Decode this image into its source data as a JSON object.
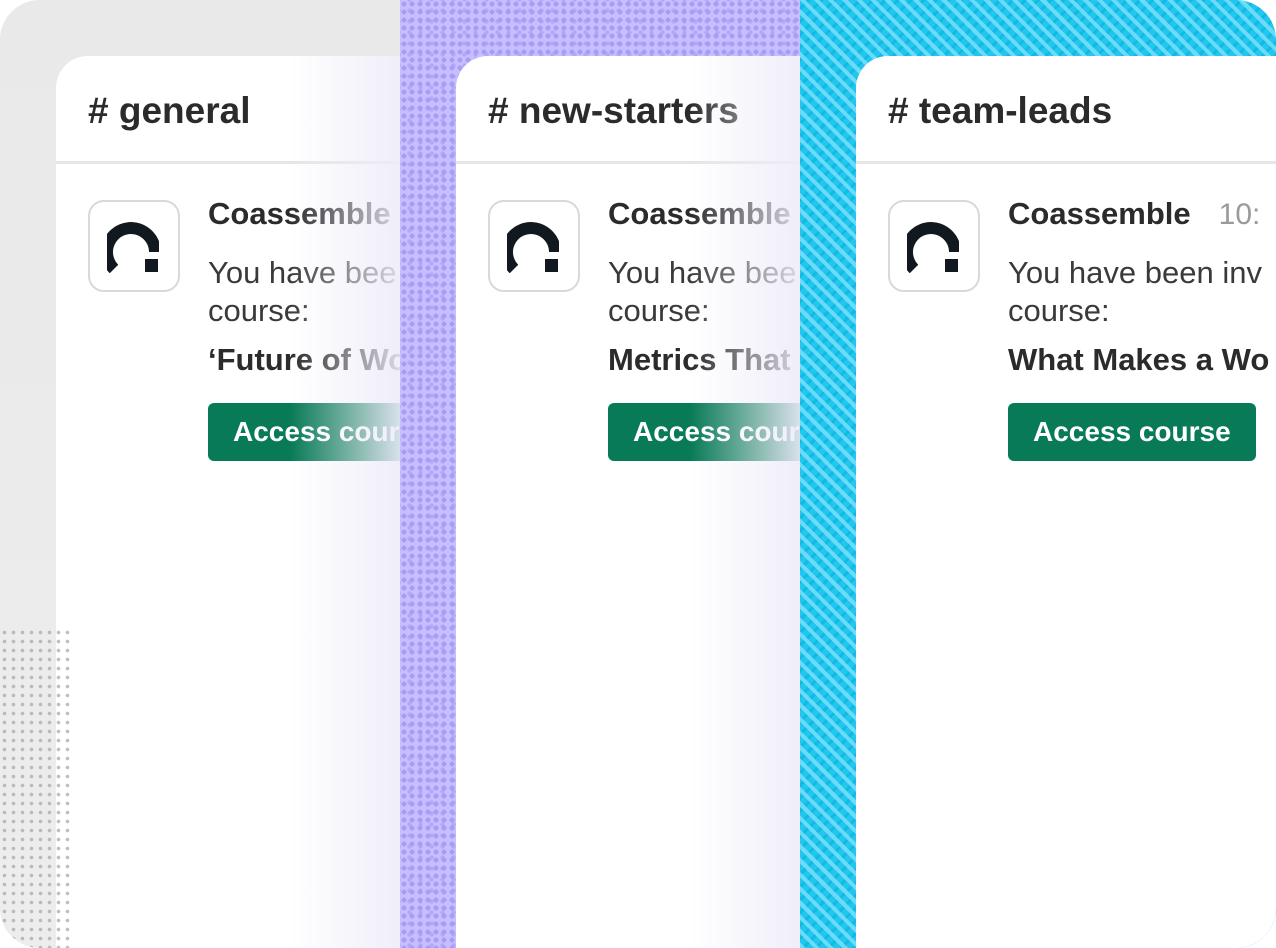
{
  "colors": {
    "strip_1_background": "#ececec",
    "strip_2_background": "#c6bfff",
    "strip_3_background": "#22c6ee",
    "button_green": "#087a57",
    "logo": "#111820"
  },
  "icons": {
    "logo": "coassemble-logo-icon"
  },
  "channels": [
    {
      "title": "# general",
      "sender": "Coassemble",
      "timestamp": "",
      "message_line_1": "You have bee",
      "message_line_2": "course:",
      "course_title": "‘Future of Wo",
      "button_label": "Access cour"
    },
    {
      "title": "# new-starters",
      "sender": "Coassemble",
      "timestamp": "",
      "message_line_1": "You have bee",
      "message_line_2": "course:",
      "course_title": "Metrics That",
      "button_label": "Access cour"
    },
    {
      "title": "# team-leads",
      "sender": "Coassemble",
      "timestamp": "10:",
      "message_line_1": "You have been inv",
      "message_line_2": "course:",
      "course_title": "What Makes a Wo",
      "button_label": "Access course"
    }
  ]
}
